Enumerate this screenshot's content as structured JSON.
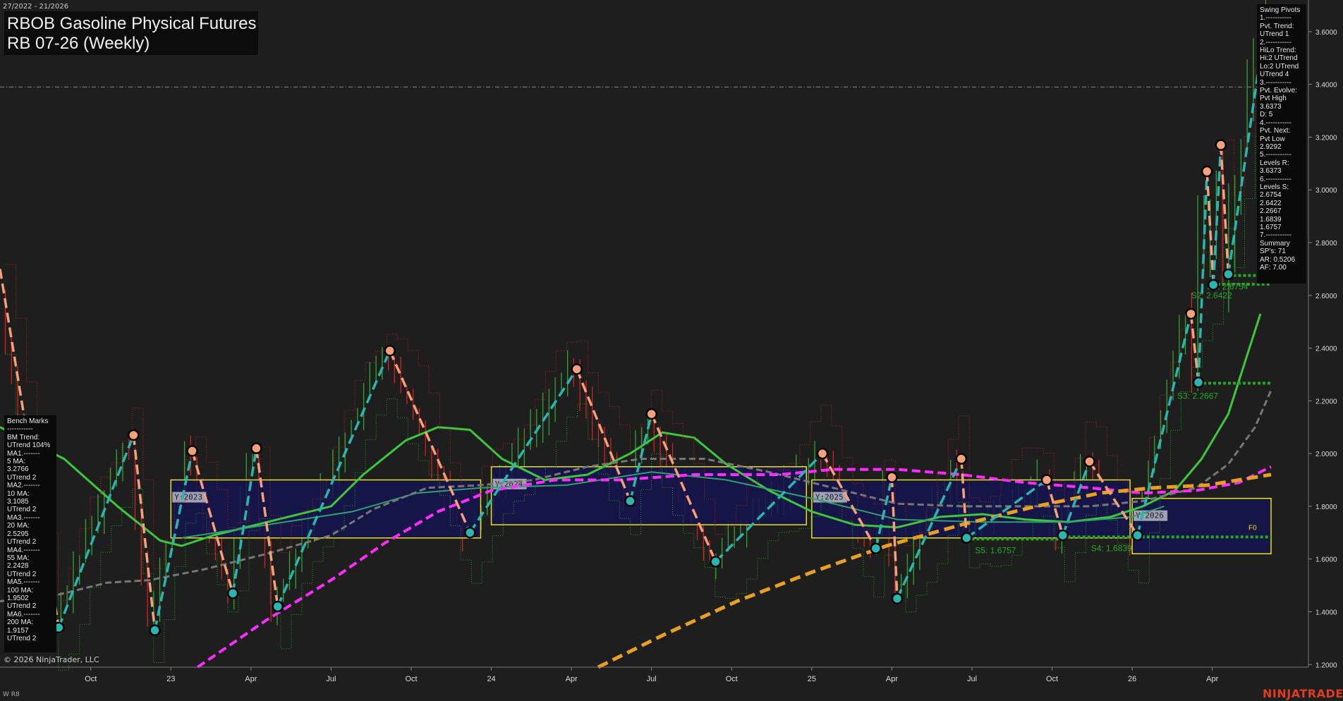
{
  "header": {
    "date_range": "27/2022 - 21/2026",
    "title_line1": "RBOB Gasoline Physical Futures",
    "title_line2": "RB 07-26 (Weekly)"
  },
  "pivot_panel": {
    "lines": [
      "Swing Pivots",
      "1.-----------",
      "Pvt. Trend:",
      "UTrend 1",
      "2.-----------",
      "HiLo Trend:",
      "Hi:2 UTrend",
      "Lo:2 UTrend",
      "UTrend 4",
      "3.-----------",
      "Pvt. Evolve:",
      "Pvt High",
      "3.6373",
      "D: 5",
      "4.-----------",
      "Pvt. Next:",
      "Pvt Low",
      "2.9292",
      "5.-----------",
      "Levels R:",
      "3.6373",
      "6.-----------",
      "Levels S:",
      "2.6754",
      "2.6422",
      "2.2667",
      "1.6839",
      "1.6757",
      "7.-----------",
      "Summary",
      "SP's: 71",
      "AR: 0.5206",
      "AF: 7.00"
    ]
  },
  "bench_panel": {
    "lines": [
      "Bench Marks",
      "-----------",
      "BM Trend:",
      "UTrend 104%",
      "MA1.-------",
      "5 MA:",
      "3.2766",
      "UTrend 2",
      "MA2.-------",
      "10 MA:",
      "3.1085",
      "UTrend 2",
      "MA3.-------",
      "20 MA:",
      "2.5295",
      "UTrend 2",
      "MA4.-------",
      "55 MA:",
      "2.2428",
      "UTrend 2",
      "MA5.-------",
      "100 MA:",
      "1.9502",
      "UTrend 2",
      "MA6.-------",
      "200 MA:",
      "1.9157",
      "UTrend 2"
    ]
  },
  "footer": {
    "copyright": "© 2026 NinjaTrader, LLC",
    "brand": "NINJATRADER",
    "corner": "W R8"
  },
  "colors": {
    "background": "#1e1e1e",
    "up_bar": "#2ea82e",
    "down_bar": "#d42020",
    "pivot_high": "#f4a07a",
    "pivot_low": "#2ab5b0",
    "ma_green": "#3cc83c",
    "ma_gray": "#777777",
    "ma_magenta": "#ff2cff",
    "ma_orange": "#e8a020",
    "year_box_fill": "#141450",
    "year_box_edge": "#e8e020",
    "support_green": "#22aa22"
  },
  "chart_data": {
    "type": "line",
    "ylim": [
      1.19,
      3.72
    ],
    "y_ticks": [
      "1.2000",
      "1.4000",
      "1.6000",
      "1.8000",
      "2.0000",
      "2.2000",
      "2.4000",
      "2.6000",
      "2.8000",
      "3.0000",
      "3.2000",
      "3.4000",
      "3.6000"
    ],
    "x_ticks": [
      {
        "label": "Oct",
        "x": 0.55
      },
      {
        "label": "23",
        "x": 1.3
      },
      {
        "label": "Apr",
        "x": 2.05
      },
      {
        "label": "Jul",
        "x": 2.8
      },
      {
        "label": "Oct",
        "x": 3.55
      },
      {
        "label": "24",
        "x": 4.3
      },
      {
        "label": "Apr",
        "x": 5.05
      },
      {
        "label": "Jul",
        "x": 5.8
      },
      {
        "label": "Oct",
        "x": 6.55
      },
      {
        "label": "25",
        "x": 7.3
      },
      {
        "label": "Apr",
        "x": 8.05
      },
      {
        "label": "Jul",
        "x": 8.8
      },
      {
        "label": "Oct",
        "x": 9.55
      },
      {
        "label": "26",
        "x": 10.3
      },
      {
        "label": "Apr",
        "x": 11.05
      }
    ],
    "x_domain": [
      -0.3,
      11.95
    ],
    "reference_line": 3.39,
    "swing_pivots": [
      {
        "x": -0.3,
        "y": 2.7,
        "t": "H"
      },
      {
        "x": 0.25,
        "y": 1.34,
        "t": "L"
      },
      {
        "x": 0.95,
        "y": 2.07,
        "t": "H"
      },
      {
        "x": 1.15,
        "y": 1.33,
        "t": "L"
      },
      {
        "x": 1.5,
        "y": 2.01,
        "t": "H"
      },
      {
        "x": 1.88,
        "y": 1.47,
        "t": "L"
      },
      {
        "x": 2.1,
        "y": 2.02,
        "t": "H"
      },
      {
        "x": 2.3,
        "y": 1.42,
        "t": "L"
      },
      {
        "x": 3.35,
        "y": 2.39,
        "t": "H"
      },
      {
        "x": 4.1,
        "y": 1.7,
        "t": "L"
      },
      {
        "x": 5.1,
        "y": 2.32,
        "t": "H"
      },
      {
        "x": 5.6,
        "y": 1.82,
        "t": "L"
      },
      {
        "x": 5.8,
        "y": 2.15,
        "t": "H"
      },
      {
        "x": 6.4,
        "y": 1.59,
        "t": "L"
      },
      {
        "x": 7.4,
        "y": 2.0,
        "t": "H"
      },
      {
        "x": 7.9,
        "y": 1.64,
        "t": "L"
      },
      {
        "x": 8.05,
        "y": 1.91,
        "t": "H"
      },
      {
        "x": 8.1,
        "y": 1.45,
        "t": "L"
      },
      {
        "x": 8.7,
        "y": 1.98,
        "t": "H"
      },
      {
        "x": 8.75,
        "y": 1.68,
        "t": "L"
      },
      {
        "x": 9.5,
        "y": 1.9,
        "t": "H"
      },
      {
        "x": 9.65,
        "y": 1.69,
        "t": "L"
      },
      {
        "x": 9.9,
        "y": 1.97,
        "t": "H"
      },
      {
        "x": 10.35,
        "y": 1.69,
        "t": "L"
      },
      {
        "x": 10.85,
        "y": 2.53,
        "t": "H"
      },
      {
        "x": 10.92,
        "y": 2.27,
        "t": "L"
      },
      {
        "x": 11.0,
        "y": 3.07,
        "t": "H"
      },
      {
        "x": 11.06,
        "y": 2.64,
        "t": "L"
      },
      {
        "x": 11.13,
        "y": 3.17,
        "t": "H"
      },
      {
        "x": 11.2,
        "y": 2.68,
        "t": "L"
      },
      {
        "x": 11.55,
        "y": 3.64,
        "t": "H"
      }
    ],
    "moving_averages": [
      {
        "color": "#3cc83c",
        "dash": false,
        "width": 3,
        "points": [
          [
            -0.3,
            2.1
          ],
          [
            0.3,
            1.98
          ],
          [
            0.8,
            1.8
          ],
          [
            1.2,
            1.67
          ],
          [
            1.4,
            1.65
          ],
          [
            1.7,
            1.69
          ],
          [
            2.2,
            1.74
          ],
          [
            2.8,
            1.8
          ],
          [
            3.1,
            1.92
          ],
          [
            3.5,
            2.05
          ],
          [
            3.8,
            2.1
          ],
          [
            4.1,
            2.09
          ],
          [
            4.4,
            1.98
          ],
          [
            4.8,
            1.9
          ],
          [
            5.2,
            1.92
          ],
          [
            5.6,
            2.0
          ],
          [
            5.9,
            2.08
          ],
          [
            6.2,
            2.06
          ],
          [
            6.5,
            1.96
          ],
          [
            6.9,
            1.86
          ],
          [
            7.3,
            1.78
          ],
          [
            7.7,
            1.73
          ],
          [
            8.1,
            1.72
          ],
          [
            8.5,
            1.76
          ],
          [
            8.9,
            1.77
          ],
          [
            9.3,
            1.75
          ],
          [
            9.7,
            1.74
          ],
          [
            10.1,
            1.76
          ],
          [
            10.4,
            1.8
          ],
          [
            10.7,
            1.86
          ],
          [
            10.95,
            1.98
          ],
          [
            11.2,
            2.15
          ],
          [
            11.5,
            2.53
          ]
        ]
      },
      {
        "color": "#2fa070",
        "dash": false,
        "width": 2,
        "points": [
          [
            1.4,
            1.68
          ],
          [
            2.2,
            1.73
          ],
          [
            3.0,
            1.78
          ],
          [
            3.6,
            1.85
          ],
          [
            4.2,
            1.87
          ],
          [
            5.0,
            1.88
          ],
          [
            5.8,
            1.93
          ],
          [
            6.5,
            1.9
          ],
          [
            7.3,
            1.83
          ],
          [
            8.1,
            1.75
          ],
          [
            8.9,
            1.74
          ],
          [
            9.7,
            1.74
          ],
          [
            10.3,
            1.76
          ],
          [
            10.6,
            1.8
          ]
        ]
      },
      {
        "color": "#777777",
        "dash": true,
        "width": 3,
        "points": [
          [
            -0.3,
            1.44
          ],
          [
            0.2,
            1.46
          ],
          [
            0.7,
            1.51
          ],
          [
            1.1,
            1.52
          ],
          [
            1.6,
            1.56
          ],
          [
            2.2,
            1.62
          ],
          [
            2.8,
            1.69
          ],
          [
            3.2,
            1.79
          ],
          [
            3.7,
            1.87
          ],
          [
            4.2,
            1.88
          ],
          [
            4.7,
            1.9
          ],
          [
            5.2,
            1.95
          ],
          [
            5.7,
            1.98
          ],
          [
            6.3,
            1.98
          ],
          [
            6.9,
            1.93
          ],
          [
            7.5,
            1.87
          ],
          [
            8.1,
            1.81
          ],
          [
            8.7,
            1.8
          ],
          [
            9.3,
            1.8
          ],
          [
            9.9,
            1.8
          ],
          [
            10.4,
            1.82
          ],
          [
            10.9,
            1.87
          ],
          [
            11.2,
            1.96
          ],
          [
            11.45,
            2.1
          ],
          [
            11.6,
            2.24
          ]
        ]
      },
      {
        "color": "#ff2cff",
        "dash": true,
        "width": 4,
        "points": [
          [
            1.55,
            1.19
          ],
          [
            2.2,
            1.37
          ],
          [
            2.8,
            1.52
          ],
          [
            3.3,
            1.66
          ],
          [
            3.8,
            1.78
          ],
          [
            4.3,
            1.86
          ],
          [
            4.9,
            1.9
          ],
          [
            5.5,
            1.9
          ],
          [
            6.2,
            1.92
          ],
          [
            7.0,
            1.92
          ],
          [
            7.5,
            1.94
          ],
          [
            8.1,
            1.94
          ],
          [
            8.7,
            1.92
          ],
          [
            9.3,
            1.89
          ],
          [
            9.9,
            1.87
          ],
          [
            10.4,
            1.85
          ],
          [
            10.9,
            1.86
          ],
          [
            11.3,
            1.89
          ],
          [
            11.6,
            1.95
          ]
        ]
      },
      {
        "color": "#e8a020",
        "dash": true,
        "width": 5,
        "points": [
          [
            5.3,
            1.19
          ],
          [
            5.9,
            1.31
          ],
          [
            6.6,
            1.44
          ],
          [
            7.3,
            1.55
          ],
          [
            8.0,
            1.65
          ],
          [
            8.7,
            1.73
          ],
          [
            9.4,
            1.8
          ],
          [
            10.0,
            1.85
          ],
          [
            10.5,
            1.87
          ],
          [
            11.0,
            1.88
          ],
          [
            11.6,
            1.92
          ]
        ]
      }
    ],
    "year_boxes": [
      {
        "label": "Y:2023",
        "x0": 1.3,
        "x1": 4.2,
        "y0": 1.68,
        "y1": 1.9
      },
      {
        "label": "Y:2024",
        "x0": 4.3,
        "x1": 7.25,
        "y0": 1.73,
        "y1": 1.95
      },
      {
        "label": "Y:2025",
        "x0": 7.3,
        "x1": 10.28,
        "y0": 1.68,
        "y1": 1.9
      },
      {
        "label": "Y:2026",
        "x0": 10.3,
        "x1": 11.6,
        "y0": 1.62,
        "y1": 1.83
      }
    ],
    "support_levels": [
      {
        "label": "S1: 2.6754",
        "y": 2.6754,
        "x0": 11.2,
        "x1": 11.6
      },
      {
        "label": "S2: 2.6422",
        "y": 2.6422,
        "x0": 11.05,
        "x1": 11.6
      },
      {
        "label": "S3: 2.2667",
        "y": 2.2667,
        "x0": 10.92,
        "x1": 11.6
      },
      {
        "label": "S4: 1.6839",
        "y": 1.6839,
        "x0": 9.65,
        "x1": 11.6
      },
      {
        "label": "S5: 1.6757",
        "y": 1.6757,
        "x0": 8.75,
        "x1": 9.65
      }
    ],
    "f0_label": "F0"
  }
}
